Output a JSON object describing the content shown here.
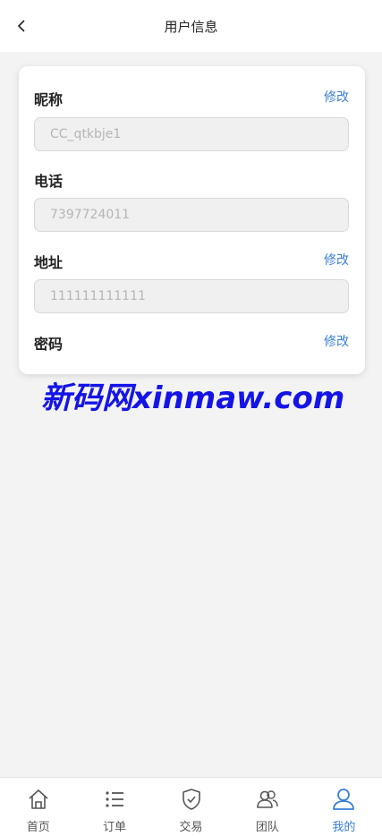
{
  "header": {
    "title": "用户信息",
    "back_icon": "chevron-left-icon"
  },
  "profile": {
    "nickname": {
      "label": "昵称",
      "edit": "修改",
      "value": "CC_qtkbje1"
    },
    "phone": {
      "label": "电话",
      "value": "7397724011"
    },
    "address": {
      "label": "地址",
      "edit": "修改",
      "value": "111111111111"
    },
    "password": {
      "label": "密码",
      "edit": "修改"
    }
  },
  "watermark": "新码网xinmaw.com",
  "tabbar": {
    "items": [
      {
        "label": "首页",
        "icon": "home-icon",
        "active": false
      },
      {
        "label": "订单",
        "icon": "list-icon",
        "active": false
      },
      {
        "label": "交易",
        "icon": "shield-check-icon",
        "active": false
      },
      {
        "label": "团队",
        "icon": "team-icon",
        "active": false
      },
      {
        "label": "我的",
        "icon": "user-icon",
        "active": true
      }
    ]
  },
  "colors": {
    "accent": "#3a7fd5",
    "background": "#f3f3f3",
    "watermark": "#1414e6"
  }
}
